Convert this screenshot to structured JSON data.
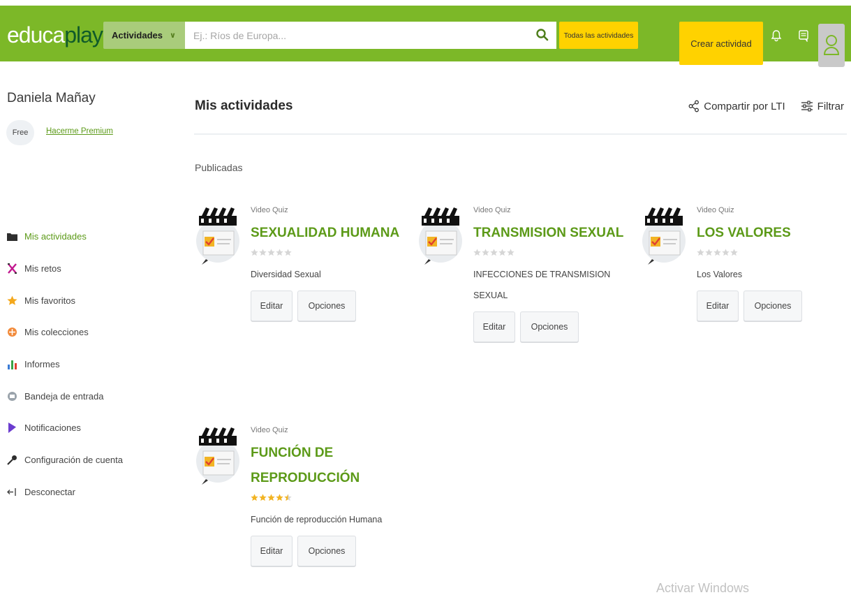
{
  "header": {
    "logo_left": "educa",
    "logo_right": "play",
    "category_select": "Actividades",
    "search_placeholder": "Ej.: Ríos de Europa...",
    "all_activities_button": "Todas las actividades",
    "create_button": "Crear actividad"
  },
  "sidebar": {
    "user_name": "Daniela Mañay",
    "plan_badge": "Free",
    "premium_link": "Hacerme Premium",
    "items": [
      {
        "label": "Mis actividades",
        "icon": "folder-icon",
        "active": true
      },
      {
        "label": "Mis retos",
        "icon": "challenge-icon",
        "active": false
      },
      {
        "label": "Mis favoritos",
        "icon": "star-icon",
        "active": false
      },
      {
        "label": "Mis colecciones",
        "icon": "collection-icon",
        "active": false
      },
      {
        "label": "Informes",
        "icon": "bar-chart-icon",
        "active": false
      },
      {
        "label": "Bandeja de entrada",
        "icon": "inbox-icon",
        "active": false
      },
      {
        "label": "Notificaciones",
        "icon": "notification-icon",
        "active": false
      },
      {
        "label": "Configuración de cuenta",
        "icon": "wrench-icon",
        "active": false
      },
      {
        "label": "Desconectar",
        "icon": "logout-icon",
        "active": false
      }
    ]
  },
  "main": {
    "title": "Mis actividades",
    "share_lti": "Compartir por LTI",
    "filter": "Filtrar",
    "section": "Publicadas",
    "activities": [
      {
        "type": "Video Quiz",
        "title": "SEXUALIDAD HUMANA",
        "description": "Diversidad Sexual",
        "rating": 0,
        "edit": "Editar",
        "options": "Opciones"
      },
      {
        "type": "Video Quiz",
        "title": "TRANSMISION SEXUAL",
        "description": "INFECCIONES DE TRANSMISION SEXUAL",
        "rating": 0,
        "edit": "Editar",
        "options": "Opciones"
      },
      {
        "type": "Video Quiz",
        "title": "LOS VALORES",
        "description": "Los Valores",
        "rating": 0,
        "edit": "Editar",
        "options": "Opciones"
      },
      {
        "type": "Video Quiz",
        "title": "FUNCIÓN DE REPRODUCCIÓN",
        "description": "Función de reproducción Humana",
        "rating": 4.5,
        "edit": "Editar",
        "options": "Opciones"
      }
    ]
  },
  "watermark": "Activar Windows",
  "colors": {
    "brand_green": "#7cb828",
    "link_green": "#5c9a18",
    "accent_yellow": "#ffd200"
  }
}
